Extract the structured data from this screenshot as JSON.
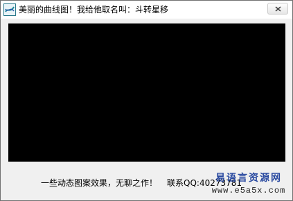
{
  "window": {
    "title": "美丽的曲线图！我给他取名叫：斗转星移"
  },
  "status": {
    "description": "一些动态图案效果，无聊之作！",
    "contact": "联系QQ:40273781"
  },
  "watermark": {
    "name": "易语言资源网",
    "url": "www.e5a5x.com"
  },
  "colors": {
    "canvas_background": "#000000",
    "window_background": "#f0f0f0",
    "watermark_blue": "#2a4aa0"
  },
  "icons": {
    "app": "app-logo-icon",
    "close": "close-icon"
  }
}
